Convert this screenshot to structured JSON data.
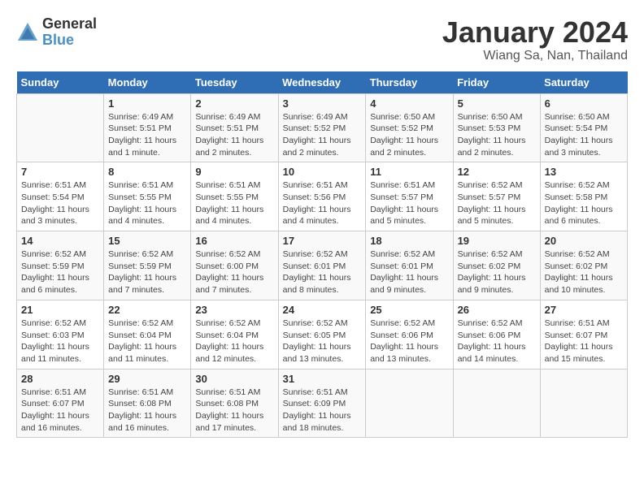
{
  "logo": {
    "general": "General",
    "blue": "Blue"
  },
  "title": "January 2024",
  "location": "Wiang Sa, Nan, Thailand",
  "days_of_week": [
    "Sunday",
    "Monday",
    "Tuesday",
    "Wednesday",
    "Thursday",
    "Friday",
    "Saturday"
  ],
  "weeks": [
    [
      {
        "day": "",
        "info": ""
      },
      {
        "day": "1",
        "info": "Sunrise: 6:49 AM\nSunset: 5:51 PM\nDaylight: 11 hours\nand 1 minute."
      },
      {
        "day": "2",
        "info": "Sunrise: 6:49 AM\nSunset: 5:51 PM\nDaylight: 11 hours\nand 2 minutes."
      },
      {
        "day": "3",
        "info": "Sunrise: 6:49 AM\nSunset: 5:52 PM\nDaylight: 11 hours\nand 2 minutes."
      },
      {
        "day": "4",
        "info": "Sunrise: 6:50 AM\nSunset: 5:52 PM\nDaylight: 11 hours\nand 2 minutes."
      },
      {
        "day": "5",
        "info": "Sunrise: 6:50 AM\nSunset: 5:53 PM\nDaylight: 11 hours\nand 2 minutes."
      },
      {
        "day": "6",
        "info": "Sunrise: 6:50 AM\nSunset: 5:54 PM\nDaylight: 11 hours\nand 3 minutes."
      }
    ],
    [
      {
        "day": "7",
        "info": "Sunrise: 6:51 AM\nSunset: 5:54 PM\nDaylight: 11 hours\nand 3 minutes."
      },
      {
        "day": "8",
        "info": "Sunrise: 6:51 AM\nSunset: 5:55 PM\nDaylight: 11 hours\nand 4 minutes."
      },
      {
        "day": "9",
        "info": "Sunrise: 6:51 AM\nSunset: 5:55 PM\nDaylight: 11 hours\nand 4 minutes."
      },
      {
        "day": "10",
        "info": "Sunrise: 6:51 AM\nSunset: 5:56 PM\nDaylight: 11 hours\nand 4 minutes."
      },
      {
        "day": "11",
        "info": "Sunrise: 6:51 AM\nSunset: 5:57 PM\nDaylight: 11 hours\nand 5 minutes."
      },
      {
        "day": "12",
        "info": "Sunrise: 6:52 AM\nSunset: 5:57 PM\nDaylight: 11 hours\nand 5 minutes."
      },
      {
        "day": "13",
        "info": "Sunrise: 6:52 AM\nSunset: 5:58 PM\nDaylight: 11 hours\nand 6 minutes."
      }
    ],
    [
      {
        "day": "14",
        "info": "Sunrise: 6:52 AM\nSunset: 5:59 PM\nDaylight: 11 hours\nand 6 minutes."
      },
      {
        "day": "15",
        "info": "Sunrise: 6:52 AM\nSunset: 5:59 PM\nDaylight: 11 hours\nand 7 minutes."
      },
      {
        "day": "16",
        "info": "Sunrise: 6:52 AM\nSunset: 6:00 PM\nDaylight: 11 hours\nand 7 minutes."
      },
      {
        "day": "17",
        "info": "Sunrise: 6:52 AM\nSunset: 6:01 PM\nDaylight: 11 hours\nand 8 minutes."
      },
      {
        "day": "18",
        "info": "Sunrise: 6:52 AM\nSunset: 6:01 PM\nDaylight: 11 hours\nand 9 minutes."
      },
      {
        "day": "19",
        "info": "Sunrise: 6:52 AM\nSunset: 6:02 PM\nDaylight: 11 hours\nand 9 minutes."
      },
      {
        "day": "20",
        "info": "Sunrise: 6:52 AM\nSunset: 6:02 PM\nDaylight: 11 hours\nand 10 minutes."
      }
    ],
    [
      {
        "day": "21",
        "info": "Sunrise: 6:52 AM\nSunset: 6:03 PM\nDaylight: 11 hours\nand 11 minutes."
      },
      {
        "day": "22",
        "info": "Sunrise: 6:52 AM\nSunset: 6:04 PM\nDaylight: 11 hours\nand 11 minutes."
      },
      {
        "day": "23",
        "info": "Sunrise: 6:52 AM\nSunset: 6:04 PM\nDaylight: 11 hours\nand 12 minutes."
      },
      {
        "day": "24",
        "info": "Sunrise: 6:52 AM\nSunset: 6:05 PM\nDaylight: 11 hours\nand 13 minutes."
      },
      {
        "day": "25",
        "info": "Sunrise: 6:52 AM\nSunset: 6:06 PM\nDaylight: 11 hours\nand 13 minutes."
      },
      {
        "day": "26",
        "info": "Sunrise: 6:52 AM\nSunset: 6:06 PM\nDaylight: 11 hours\nand 14 minutes."
      },
      {
        "day": "27",
        "info": "Sunrise: 6:51 AM\nSunset: 6:07 PM\nDaylight: 11 hours\nand 15 minutes."
      }
    ],
    [
      {
        "day": "28",
        "info": "Sunrise: 6:51 AM\nSunset: 6:07 PM\nDaylight: 11 hours\nand 16 minutes."
      },
      {
        "day": "29",
        "info": "Sunrise: 6:51 AM\nSunset: 6:08 PM\nDaylight: 11 hours\nand 16 minutes."
      },
      {
        "day": "30",
        "info": "Sunrise: 6:51 AM\nSunset: 6:08 PM\nDaylight: 11 hours\nand 17 minutes."
      },
      {
        "day": "31",
        "info": "Sunrise: 6:51 AM\nSunset: 6:09 PM\nDaylight: 11 hours\nand 18 minutes."
      },
      {
        "day": "",
        "info": ""
      },
      {
        "day": "",
        "info": ""
      },
      {
        "day": "",
        "info": ""
      }
    ]
  ]
}
